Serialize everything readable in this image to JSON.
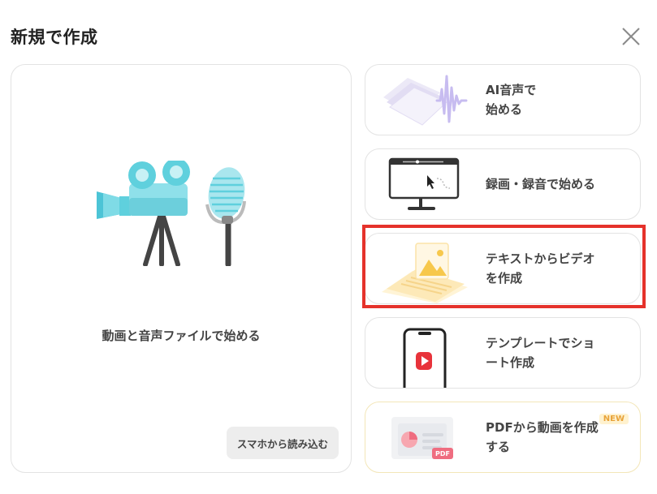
{
  "dialog": {
    "title": "新規で作成",
    "close_icon": "close-icon"
  },
  "main_option": {
    "label": "動画と音声ファイルで始める",
    "import_button": "スマホから読み込む",
    "icon": "camera-microphone-illustration"
  },
  "options": [
    {
      "id": "ai-voice",
      "label": "AI音声で\n始める",
      "icon": "waveform-document-illustration"
    },
    {
      "id": "record",
      "label": "録画・録音で始める",
      "icon": "monitor-cursor-illustration"
    },
    {
      "id": "text-to-video",
      "label": "テキストからビデオ\nを作成",
      "icon": "image-document-illustration",
      "highlighted": true
    },
    {
      "id": "template",
      "label": "テンプレートでショ\nート作成",
      "icon": "smartphone-shorts-illustration"
    },
    {
      "id": "pdf",
      "label": "PDFから動画を作成\nする",
      "icon": "pdf-document-illustration",
      "badge": "NEW",
      "pdf_tag": "PDF"
    }
  ],
  "colors": {
    "highlight": "#e5322b",
    "badge_bg": "#fff2cf",
    "badge_text": "#e8a33a",
    "accent_cyan": "#5fd0dd"
  }
}
